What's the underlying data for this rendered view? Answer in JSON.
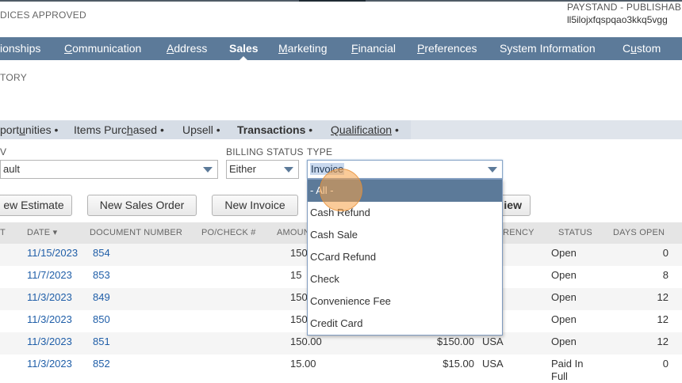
{
  "header": {
    "status_text": "DICES APPROVED",
    "paystand_label": "PAYSTAND - PUBLISHABLE",
    "paystand_key": "ll5ilojxfqspqao3kkq5vgg"
  },
  "main_nav": {
    "tabs": [
      {
        "label": "ionships",
        "active": false
      },
      {
        "label": "Communication",
        "active": false,
        "ak": "C",
        "rest": "ommunication"
      },
      {
        "label": "Address",
        "active": false,
        "ak": "A",
        "rest": "ddress"
      },
      {
        "label": "Sales",
        "active": true
      },
      {
        "label": "Marketing",
        "active": false,
        "ak": "M",
        "rest": "arketing"
      },
      {
        "label": "Financial",
        "active": false,
        "ak": "F",
        "rest": "inancial"
      },
      {
        "label": "Preferences",
        "active": false,
        "ak": "P",
        "rest": "references"
      },
      {
        "label": "System Information",
        "active": false
      },
      {
        "label": "Custom",
        "active": false,
        "pre": "C",
        "ak": "u",
        "rest": "stom"
      }
    ]
  },
  "section_title": "TORY",
  "subtabs": {
    "opportunities": {
      "pre": "port",
      "ak": "u",
      "rest": "nities"
    },
    "items_purchased": {
      "pre": "Items Purc",
      "ak": "h",
      "rest": "ased"
    },
    "upsell": "Upsell",
    "transactions": "Transactions",
    "qualification": "Qualification",
    "separator": "•"
  },
  "filters": {
    "view_label": "V",
    "view_value": "ault",
    "billing_status_label": "BILLING STATUS",
    "billing_status_value": "Either",
    "type_label": "TYPE",
    "type_value": "Invoice"
  },
  "buttons": {
    "new_estimate": "ew Estimate",
    "new_sales_order": "New Sales Order",
    "new_invoice": "New Invoice",
    "view_partial": "iew"
  },
  "table": {
    "headers": {
      "col0": "T",
      "date": "DATE ▾",
      "document_number": "DOCUMENT NUMBER",
      "po_check": "PO/CHECK #",
      "amount": "AMOUN",
      "currency": "RRENCY",
      "status": "STATUS",
      "days_open": "DAYS OPEN"
    },
    "rows": [
      {
        "date": "11/15/2023",
        "doc": "854",
        "amount": "150",
        "amount_due": "",
        "currency": "",
        "status": "Open",
        "days": "0"
      },
      {
        "date": "11/7/2023",
        "doc": "853",
        "amount": "15",
        "amount_due": "",
        "currency": "",
        "status": "Open",
        "days": "8"
      },
      {
        "date": "11/3/2023",
        "doc": "849",
        "amount": "150",
        "amount_due": "",
        "currency": "",
        "status": "Open",
        "days": "12"
      },
      {
        "date": "11/3/2023",
        "doc": "850",
        "amount": "150",
        "amount_due": "",
        "currency": "",
        "status": "Open",
        "days": "12"
      },
      {
        "date": "11/3/2023",
        "doc": "851",
        "amount": "150.00",
        "amount_due": "$150.00",
        "currency": "USA",
        "status": "Open",
        "days": "12"
      },
      {
        "date": "11/3/2023",
        "doc": "852",
        "amount": "15.00",
        "amount_due": "$15.00",
        "currency": "USA",
        "status": "Paid In",
        "status2": "Full",
        "days": "0"
      }
    ]
  },
  "type_dropdown": {
    "options": [
      "- All -",
      "Cash Refund",
      "Cash Sale",
      "CCard Refund",
      "Check",
      "Convenience Fee",
      "Credit Card"
    ],
    "selected_index": 0
  },
  "colors": {
    "nav_bg": "#5c7a99",
    "link": "#1f5ea8",
    "cursor_highlight": "#f5a046"
  }
}
